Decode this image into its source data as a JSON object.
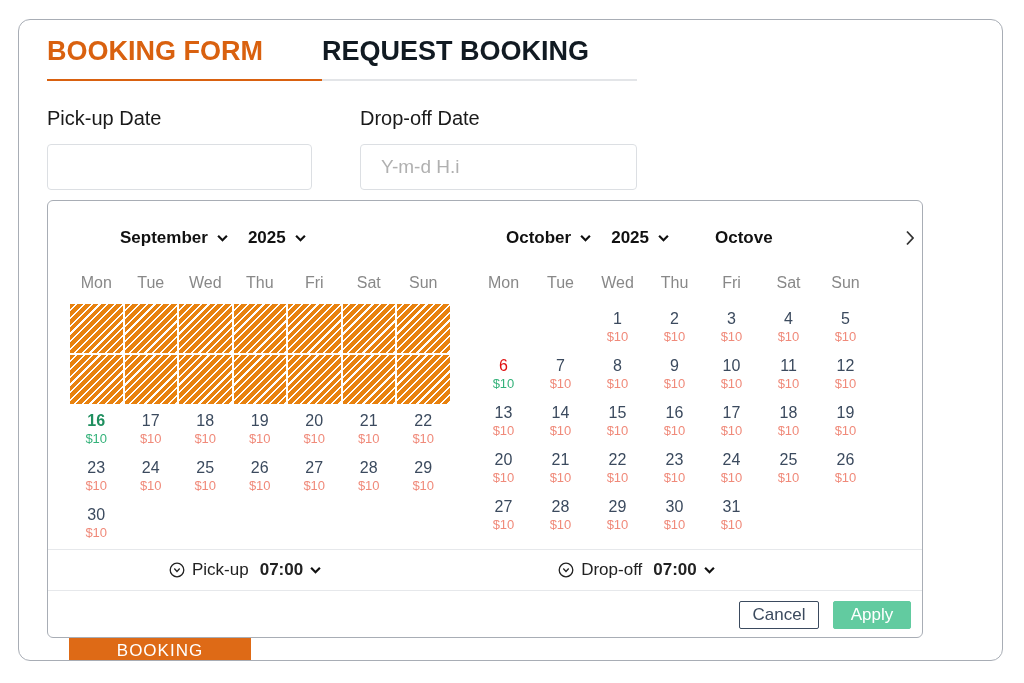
{
  "tabs": [
    {
      "label": "BOOKING FORM",
      "selected": true
    },
    {
      "label": "REQUEST BOOKING",
      "selected": false
    }
  ],
  "fields": [
    {
      "label": "Pick-up Date"
    },
    {
      "label": "Drop-off Date",
      "placeholder": "Y-m-d H.i"
    }
  ],
  "booking_button": "BOOKING",
  "calendars": [
    {
      "month": "September",
      "year": "2025",
      "weekdays": [
        "Mon",
        "Tue",
        "Wed",
        "Thu",
        "Fri",
        "Sat",
        "Sun"
      ],
      "days": [
        {
          "kind": "blocked"
        },
        {
          "kind": "blocked"
        },
        {
          "kind": "blocked"
        },
        {
          "kind": "blocked"
        },
        {
          "kind": "blocked"
        },
        {
          "kind": "blocked"
        },
        {
          "kind": "blocked"
        },
        {
          "kind": "blocked"
        },
        {
          "kind": "blocked"
        },
        {
          "kind": "blocked"
        },
        {
          "kind": "blocked"
        },
        {
          "kind": "blocked"
        },
        {
          "kind": "blocked"
        },
        {
          "kind": "blocked"
        },
        {
          "kind": "start",
          "day": "16",
          "price": "$10"
        },
        {
          "kind": "date",
          "day": "17",
          "price": "$10"
        },
        {
          "kind": "date",
          "day": "18",
          "price": "$10"
        },
        {
          "kind": "date",
          "day": "19",
          "price": "$10"
        },
        {
          "kind": "date",
          "day": "20",
          "price": "$10"
        },
        {
          "kind": "date",
          "day": "21",
          "price": "$10"
        },
        {
          "kind": "date",
          "day": "22",
          "price": "$10"
        },
        {
          "kind": "date",
          "day": "23",
          "price": "$10"
        },
        {
          "kind": "date",
          "day": "24",
          "price": "$10"
        },
        {
          "kind": "date",
          "day": "25",
          "price": "$10"
        },
        {
          "kind": "date",
          "day": "26",
          "price": "$10"
        },
        {
          "kind": "date",
          "day": "27",
          "price": "$10"
        },
        {
          "kind": "date",
          "day": "28",
          "price": "$10"
        },
        {
          "kind": "date",
          "day": "29",
          "price": "$10"
        },
        {
          "kind": "date",
          "day": "30",
          "price": "$10"
        }
      ]
    },
    {
      "month": "October",
      "year": "2025",
      "title": "Octove",
      "weekdays": [
        "Mon",
        "Tue",
        "Wed",
        "Thu",
        "Fri",
        "Sat",
        "Sun"
      ],
      "days": [
        {
          "kind": "blank"
        },
        {
          "kind": "blank"
        },
        {
          "kind": "date",
          "day": "1",
          "price": "$10"
        },
        {
          "kind": "date",
          "day": "2",
          "price": "$10"
        },
        {
          "kind": "date",
          "day": "3",
          "price": "$10"
        },
        {
          "kind": "date",
          "day": "4",
          "price": "$10"
        },
        {
          "kind": "date",
          "day": "5",
          "price": "$10"
        },
        {
          "kind": "marked",
          "day": "6",
          "price": "$10"
        },
        {
          "kind": "date",
          "day": "7",
          "price": "$10"
        },
        {
          "kind": "date",
          "day": "8",
          "price": "$10"
        },
        {
          "kind": "date",
          "day": "9",
          "price": "$10"
        },
        {
          "kind": "date",
          "day": "10",
          "price": "$10"
        },
        {
          "kind": "date",
          "day": "11",
          "price": "$10"
        },
        {
          "kind": "date",
          "day": "12",
          "price": "$10"
        },
        {
          "kind": "date",
          "day": "13",
          "price": "$10"
        },
        {
          "kind": "date",
          "day": "14",
          "price": "$10"
        },
        {
          "kind": "date",
          "day": "15",
          "price": "$10"
        },
        {
          "kind": "date",
          "day": "16",
          "price": "$10"
        },
        {
          "kind": "date",
          "day": "17",
          "price": "$10"
        },
        {
          "kind": "date",
          "day": "18",
          "price": "$10"
        },
        {
          "kind": "date",
          "day": "19",
          "price": "$10"
        },
        {
          "kind": "date",
          "day": "20",
          "price": "$10"
        },
        {
          "kind": "date",
          "day": "21",
          "price": "$10"
        },
        {
          "kind": "date",
          "day": "22",
          "price": "$10"
        },
        {
          "kind": "date",
          "day": "23",
          "price": "$10"
        },
        {
          "kind": "date",
          "day": "24",
          "price": "$10"
        },
        {
          "kind": "date",
          "day": "25",
          "price": "$10"
        },
        {
          "kind": "date",
          "day": "26",
          "price": "$10"
        },
        {
          "kind": "date",
          "day": "27",
          "price": "$10"
        },
        {
          "kind": "date",
          "day": "28",
          "price": "$10"
        },
        {
          "kind": "date",
          "day": "29",
          "price": "$10"
        },
        {
          "kind": "date",
          "day": "30",
          "price": "$10"
        },
        {
          "kind": "date",
          "day": "31",
          "price": "$10"
        }
      ]
    }
  ],
  "times": [
    {
      "label": "Pick-up",
      "value": "07:00"
    },
    {
      "label": "Drop-off",
      "value": "07:00"
    }
  ],
  "actions": [
    {
      "label": "Cancel",
      "kind": "secondary"
    },
    {
      "label": "Apply",
      "kind": "primary"
    }
  ]
}
